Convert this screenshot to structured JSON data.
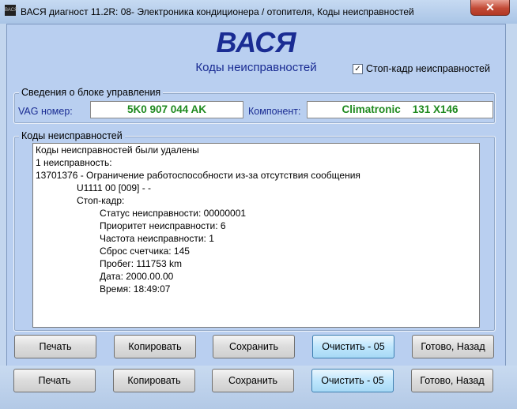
{
  "window": {
    "app_icon_label": "ВАСЯ",
    "title": "ВАСЯ диагност 11.2R: 08- Электроника кондиционера / отопителя,  Коды неисправностей",
    "close_label": "✕"
  },
  "header": {
    "brand": "ВАСЯ",
    "subtitle": "Коды неисправностей",
    "freeze_frame": {
      "label": "Стоп-кадр неисправностей",
      "checked": true,
      "mark": "✓"
    }
  },
  "control_unit": {
    "legend": "Сведения о блоке управления",
    "vag_label": "VAG номер:",
    "vag_value": "5K0 907 044 AK",
    "component_label": "Компонент:",
    "component_value": "Climatronic    131 X146"
  },
  "fault_codes": {
    "legend": "Коды неисправностей",
    "lines": [
      "Коды неисправностей были удалены",
      "1 неисправность:",
      "13701376 - Ограничение работоспособности из-за отсутствия сообщения",
      "U1111 00 [009] -  -",
      "Стоп-кадр:",
      "Статус неисправности: 00000001",
      "Приоритет неисправности: 6",
      "Частота неисправности: 1",
      "Сброс счетчика: 145",
      "Пробег: 111753 km",
      "Дата: 2000.00.00",
      "Время: 18:49:07"
    ]
  },
  "buttons": {
    "print": "Печать",
    "copy": "Копировать",
    "save": "Сохранить",
    "clear": "Очистить - 05",
    "done": "Готово, Назад"
  },
  "colors": {
    "brand": "#1a2c93",
    "field_text": "#1f8a1f",
    "client_bg": "#b9cff0"
  }
}
